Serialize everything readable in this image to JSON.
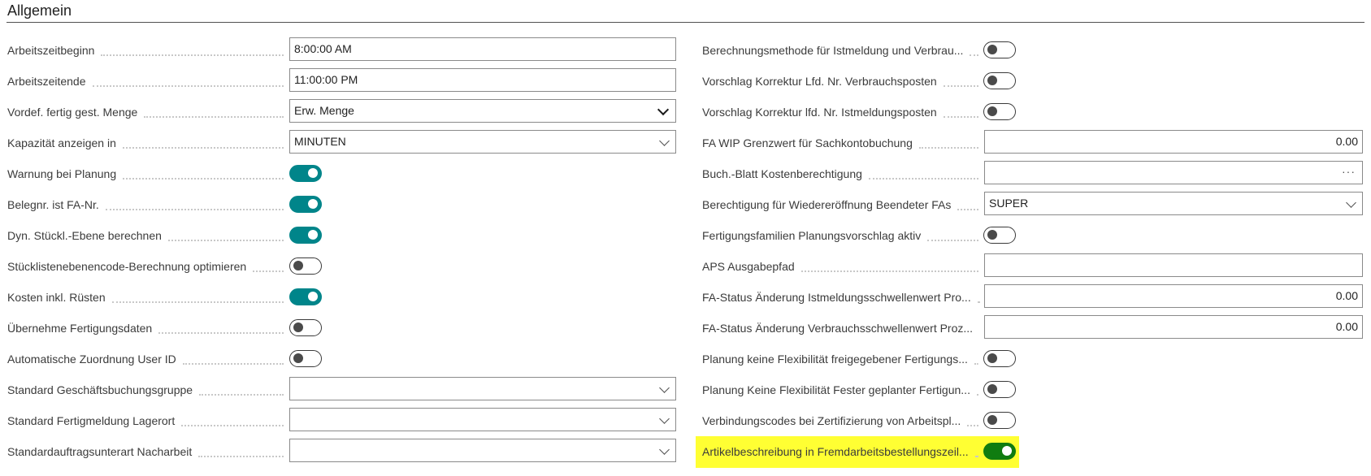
{
  "section": {
    "title": "Allgemein"
  },
  "colors": {
    "toggle_on": "#00858a",
    "toggle_on_green": "#107c10",
    "highlight": "#ffff33"
  },
  "left_fields": [
    {
      "label": "Arbeitszeitbeginn",
      "type": "text",
      "value": "8:00:00 AM"
    },
    {
      "label": "Arbeitszeitende",
      "type": "text",
      "value": "11:00:00 PM"
    },
    {
      "label": "Vordef. fertig gest. Menge",
      "type": "select",
      "value": "Erw. Menge"
    },
    {
      "label": "Kapazität anzeigen in",
      "type": "lookup",
      "value": "MINUTEN"
    },
    {
      "label": "Warnung bei Planung",
      "type": "toggle",
      "on": true
    },
    {
      "label": "Belegnr. ist FA-Nr.",
      "type": "toggle",
      "on": true
    },
    {
      "label": "Dyn. Stückl.-Ebene berechnen",
      "type": "toggle",
      "on": true
    },
    {
      "label": "Stücklistenebenencode-Berechnung optimieren",
      "type": "toggle",
      "on": false
    },
    {
      "label": "Kosten inkl. Rüsten",
      "type": "toggle",
      "on": true
    },
    {
      "label": "Übernehme Fertigungsdaten",
      "type": "toggle",
      "on": false
    },
    {
      "label": "Automatische Zuordnung User ID",
      "type": "toggle",
      "on": false
    },
    {
      "label": "Standard Geschäftsbuchungsgruppe",
      "type": "lookup",
      "value": ""
    },
    {
      "label": "Standard Fertigmeldung Lagerort",
      "type": "lookup",
      "value": ""
    },
    {
      "label": "Standardauftragsunterart Nacharbeit",
      "type": "lookup",
      "value": ""
    }
  ],
  "right_fields": [
    {
      "label": "Berechnungsmethode für Istmeldung und Verbrau...",
      "type": "toggle",
      "on": false
    },
    {
      "label": "Vorschlag Korrektur Lfd. Nr. Verbrauchsposten",
      "type": "toggle",
      "on": false
    },
    {
      "label": "Vorschlag Korrektur lfd. Nr. Istmeldungsposten",
      "type": "toggle",
      "on": false
    },
    {
      "label": "FA WIP Grenzwert für Sachkontobuchung",
      "type": "number",
      "value": "0.00"
    },
    {
      "label": "Buch.-Blatt Kostenberechtigung",
      "type": "assist",
      "value": "",
      "assist": "···"
    },
    {
      "label": "Berechtigung für Wiedereröffnung Beendeter FAs",
      "type": "lookup",
      "value": "SUPER"
    },
    {
      "label": "Fertigungsfamilien Planungsvorschlag aktiv",
      "type": "toggle",
      "on": false
    },
    {
      "label": "APS Ausgabepfad",
      "type": "text",
      "value": ""
    },
    {
      "label": "FA-Status Änderung Istmeldungsschwellenwert Pro...",
      "type": "number",
      "value": "0.00"
    },
    {
      "label": "FA-Status Änderung Verbrauchsschwellenwert Proz...",
      "type": "number",
      "value": "0.00"
    },
    {
      "label": "Planung keine Flexibilität freigegebener Fertigungs...",
      "type": "toggle",
      "on": false
    },
    {
      "label": "Planung Keine Flexibilität Fester geplanter Fertigun...",
      "type": "toggle",
      "on": false
    },
    {
      "label": "Verbindungscodes bei Zertifizierung von Arbeitspl...",
      "type": "toggle",
      "on": false
    },
    {
      "label": "Artikelbeschreibung in Fremdarbeitsbestellungszeil...",
      "type": "toggle",
      "on": true,
      "highlighted": true
    }
  ]
}
